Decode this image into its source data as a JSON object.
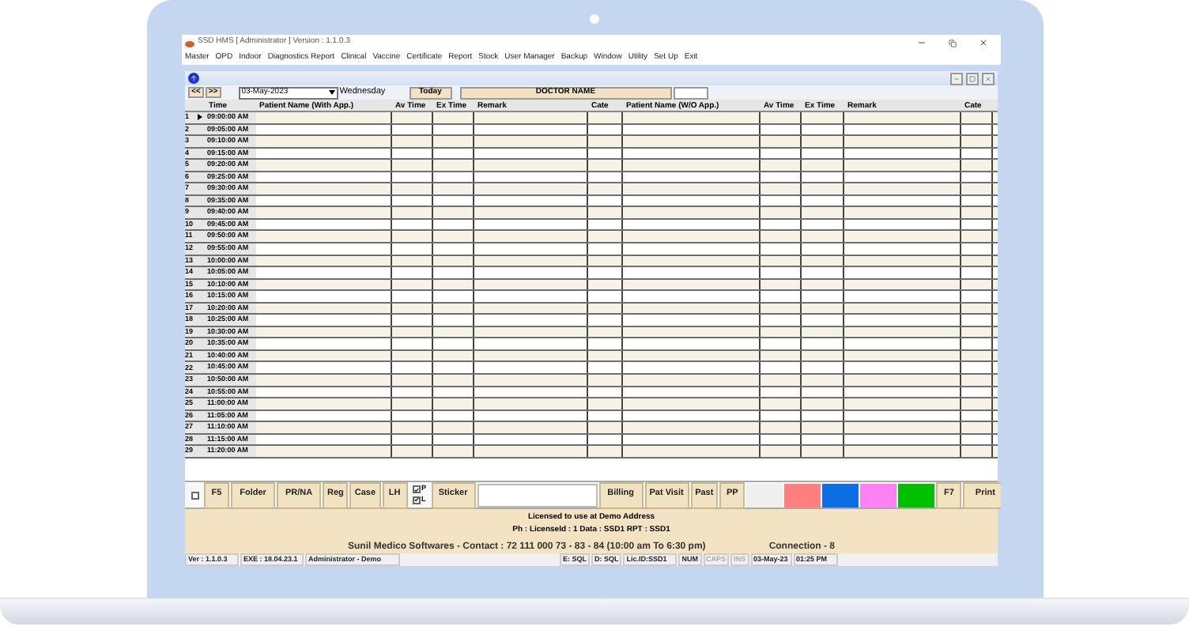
{
  "window": {
    "title": "SSD HMS [ Administrator ] Version : 1.1.0.3"
  },
  "menu": [
    "Master",
    "OPD",
    "Indoor",
    "Diagnostics Report",
    "Clinical",
    "Vaccine",
    "Certificate",
    "Report",
    "Stock",
    "User Manager",
    "Backup",
    "Window",
    "Utility",
    "Set Up",
    "Exit"
  ],
  "toolbar": {
    "prev": "<<",
    "next": ">>",
    "date": "03-May-2023",
    "day": "Wednesday",
    "today": "Today",
    "doctor": "DOCTOR NAME"
  },
  "columns": [
    "Time",
    "Patient Name (With App.)",
    "Av Time",
    "Ex Time",
    "Remark",
    "Cate",
    "Patient Name (W/O App.)",
    "Av Time",
    "Ex Time",
    "Remark",
    "Cate"
  ],
  "rows": [
    {
      "number": "1",
      "time": "09:00:00 AM",
      "current": true
    },
    {
      "number": "2",
      "time": "09:05:00 AM",
      "current": false
    },
    {
      "number": "3",
      "time": "09:10:00 AM",
      "current": false
    },
    {
      "number": "4",
      "time": "09:15:00 AM",
      "current": false
    },
    {
      "number": "5",
      "time": "09:20:00 AM",
      "current": false
    },
    {
      "number": "6",
      "time": "09:25:00 AM",
      "current": false
    },
    {
      "number": "7",
      "time": "09:30:00 AM",
      "current": false
    },
    {
      "number": "8",
      "time": "09:35:00 AM",
      "current": false
    },
    {
      "number": "9",
      "time": "09:40:00 AM",
      "current": false
    },
    {
      "number": "10",
      "time": "09:45:00 AM",
      "current": false
    },
    {
      "number": "11",
      "time": "09:50:00 AM",
      "current": false
    },
    {
      "number": "12",
      "time": "09:55:00 AM",
      "current": false
    },
    {
      "number": "13",
      "time": "10:00:00 AM",
      "current": false
    },
    {
      "number": "14",
      "time": "10:05:00 AM",
      "current": false
    },
    {
      "number": "15",
      "time": "10:10:00 AM",
      "current": false
    },
    {
      "number": "16",
      "time": "10:15:00 AM",
      "current": false
    },
    {
      "number": "17",
      "time": "10:20:00 AM",
      "current": false
    },
    {
      "number": "18",
      "time": "10:25:00 AM",
      "current": false
    },
    {
      "number": "19",
      "time": "10:30:00 AM",
      "current": false
    },
    {
      "number": "20",
      "time": "10:35:00 AM",
      "current": false
    },
    {
      "number": "21",
      "time": "10:40:00 AM",
      "current": false
    },
    {
      "number": "22",
      "time": "10:45:00 AM",
      "current": false
    },
    {
      "number": "23",
      "time": "10:50:00 AM",
      "current": false
    },
    {
      "number": "24",
      "time": "10:55:00 AM",
      "current": false
    },
    {
      "number": "25",
      "time": "11:00:00 AM",
      "current": false
    },
    {
      "number": "26",
      "time": "11:05:00 AM",
      "current": false
    },
    {
      "number": "27",
      "time": "11:10:00 AM",
      "current": false
    },
    {
      "number": "28",
      "time": "11:15:00 AM",
      "current": false
    },
    {
      "number": "29",
      "time": "11:20:00 AM",
      "current": false
    }
  ],
  "bottom_bar": [
    {
      "kind": "checkbox",
      "checked": false
    },
    {
      "kind": "button",
      "label": "F5"
    },
    {
      "kind": "button",
      "label": "Folder"
    },
    {
      "kind": "button",
      "label": "PR/NA"
    },
    {
      "kind": "button",
      "label": "Reg"
    },
    {
      "kind": "button",
      "label": "Case"
    },
    {
      "kind": "button",
      "label": "LH"
    },
    {
      "kind": "checks",
      "items": [
        {
          "label": "P",
          "checked": true
        },
        {
          "label": "L",
          "checked": true
        }
      ]
    },
    {
      "kind": "button",
      "label": "Sticker"
    },
    {
      "kind": "field"
    },
    {
      "kind": "button",
      "label": "Billing"
    },
    {
      "kind": "button",
      "label": "Pat Visit"
    },
    {
      "kind": "button",
      "label": "Past"
    },
    {
      "kind": "button",
      "label": "PP"
    },
    {
      "kind": "swatch",
      "color": "#efefef"
    },
    {
      "kind": "swatch",
      "color": "#ff7f7f"
    },
    {
      "kind": "swatch",
      "color": "#0b6fe3"
    },
    {
      "kind": "swatch",
      "color": "#ff80f2"
    },
    {
      "kind": "swatch",
      "color": "#00c000"
    },
    {
      "kind": "button",
      "label": "F7"
    },
    {
      "kind": "button",
      "label": "Print"
    }
  ],
  "footer": {
    "license": "Licensed to use at Demo Address",
    "details": "Ph :   LicenseId : 1   Data : SSD1 RPT : SSD1",
    "contact": "Sunil Medico Softwares - Contact : 72 111 000 73 - 83 - 84  (10:00 am To 6:30 pm)",
    "connection": "Connection - 8"
  },
  "status_bar": [
    {
      "text": "Ver : 1.1.0.3",
      "disabled": false
    },
    {
      "text": "EXE : 18.04.23.1",
      "disabled": false
    },
    {
      "text": "Administrator - Demo",
      "disabled": false
    },
    {
      "text": "E: SQL",
      "disabled": false
    },
    {
      "text": "D: SQL",
      "disabled": false
    },
    {
      "text": "Lic.ID:SSD1",
      "disabled": false
    },
    {
      "text": "NUM",
      "disabled": false
    },
    {
      "text": "CAPS",
      "disabled": true
    },
    {
      "text": "INS",
      "disabled": true
    },
    {
      "text": "03-May-23",
      "disabled": false
    },
    {
      "text": "01:25 PM",
      "disabled": false
    }
  ]
}
